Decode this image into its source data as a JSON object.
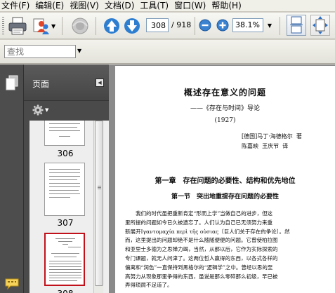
{
  "menu": [
    "文件(F)",
    "编辑(E)",
    "视图(V)",
    "文档(D)",
    "工具(T)",
    "窗口(W)",
    "帮助(H)"
  ],
  "toolbar": {
    "current_page": "308",
    "total_pages": "/ 918",
    "zoom": "38.1%"
  },
  "find": {
    "placeholder": "查找"
  },
  "panel": {
    "title": "页面"
  },
  "thumbnails": [
    {
      "label": "306"
    },
    {
      "label": "307"
    },
    {
      "label": "308"
    }
  ],
  "document": {
    "title": "概述存在意义的问题",
    "subtitle": "——《存在与时间》导论",
    "year": "(1927)",
    "authors": "[德国]马丁·海德格尔  著\n陈嘉映  王庆节  译",
    "chapter": "第一章　存在问题的必要性、结构和优先地位",
    "section": "第一节　突出地重提存在问题的必要性",
    "body": [
      "我们的时代虽把重新肯定“形而上学”当做自己的进步，但这",
      "里所提的问题如今已久被遗忘了。人们认为自己已无须努力来重",
      "新展开Ιγαντομαχία περὶ τῆς οὐσιας〔巨人们关于存在的争论〕。然",
      "而，这里提出的问题却绝不是什么随随便便的问题。它曾使柏拉图",
      "和亚里士多德为之思殚力竭，当然，从那以后，它作为实际探索的",
      "专门课题，就无人问津了。这两位哲人赢得的东西，以各式各样的",
      "偏离和“润色”一直保持到黑格尔的“逻辑学”之中。曾经以思的至",
      "高努力从现象那里争得的东西，虽说是那么零碎那么初级，早已被",
      "弄得琐屑不足道了。"
    ]
  }
}
